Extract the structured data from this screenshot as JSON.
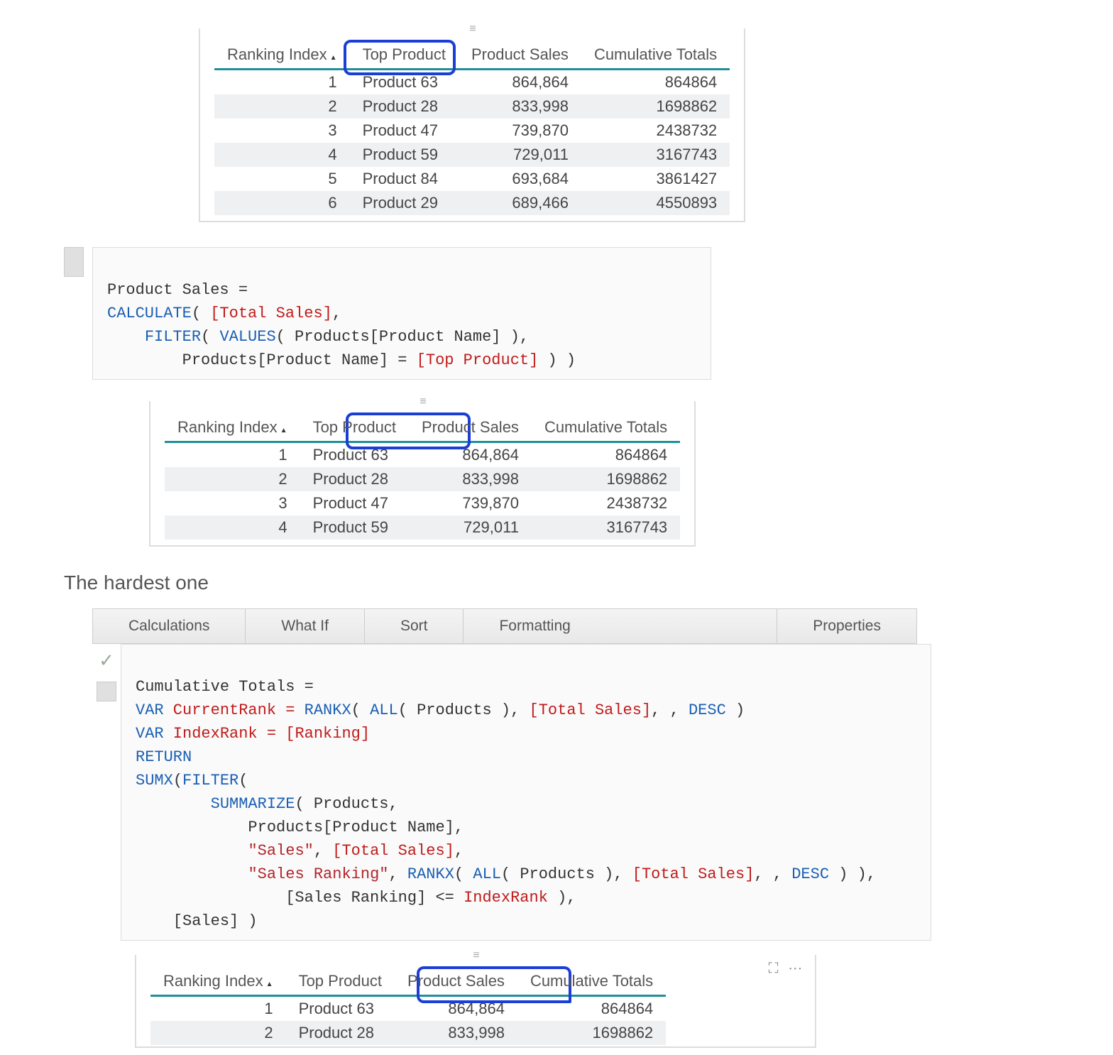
{
  "table1": {
    "headers": [
      "Ranking Index",
      "Top Product",
      "Product Sales",
      "Cumulative Totals"
    ],
    "rows": [
      {
        "idx": "1",
        "prod": "Product 63",
        "sales": "864,864",
        "cum": "864864"
      },
      {
        "idx": "2",
        "prod": "Product 28",
        "sales": "833,998",
        "cum": "1698862"
      },
      {
        "idx": "3",
        "prod": "Product 47",
        "sales": "739,870",
        "cum": "2438732"
      },
      {
        "idx": "4",
        "prod": "Product 59",
        "sales": "729,011",
        "cum": "3167743"
      },
      {
        "idx": "5",
        "prod": "Product 84",
        "sales": "693,684",
        "cum": "3861427"
      },
      {
        "idx": "6",
        "prod": "Product 29",
        "sales": "689,466",
        "cum": "4550893"
      }
    ]
  },
  "dax1": {
    "line1_a": "Product Sales =",
    "line2_fn": "CALCULATE",
    "line2_open": "( ",
    "line2_ref": "[Total Sales]",
    "line2_c": ",",
    "line3_fn1": "FILTER",
    "line3_p1": "( ",
    "line3_fn2": "VALUES",
    "line3_p2": "( Products[Product Name] ),",
    "line4_a": "        Products[Product Name] = ",
    "line4_ref": "[Top Product]",
    "line4_b": " ) )"
  },
  "table2": {
    "headers": [
      "Ranking Index",
      "Top Product",
      "Product Sales",
      "Cumulative Totals"
    ],
    "rows": [
      {
        "idx": "1",
        "prod": "Product 63",
        "sales": "864,864",
        "cum": "864864"
      },
      {
        "idx": "2",
        "prod": "Product 28",
        "sales": "833,998",
        "cum": "1698862"
      },
      {
        "idx": "3",
        "prod": "Product 47",
        "sales": "739,870",
        "cum": "2438732"
      },
      {
        "idx": "4",
        "prod": "Product 59",
        "sales": "729,011",
        "cum": "3167743"
      }
    ]
  },
  "heading": "The hardest one",
  "ribbon": [
    "Calculations",
    "What If",
    "Sort",
    "Formatting",
    "Properties"
  ],
  "dax2": {
    "l1": "Cumulative Totals =",
    "l2_a": "VAR",
    "l2_b": " CurrentRank = ",
    "l2_fn": "RANKX",
    "l2_c": "( ",
    "l2_fn2": "ALL",
    "l2_d": "( Products ), ",
    "l2_ref": "[Total Sales]",
    "l2_e": ", , ",
    "l2_kw": "DESC",
    "l2_f": " )",
    "l3_a": "VAR",
    "l3_b": " IndexRank = ",
    "l3_ref": "[Ranking]",
    "l4": "RETURN",
    "l5_fn": "SUMX",
    "l5_a": "(",
    "l5_fn2": "FILTER",
    "l5_b": "(",
    "l6_fn": "SUMMARIZE",
    "l6_a": "( Products,",
    "l7": "            Products[Product Name],",
    "l8_a": "            ",
    "l8_s": "\"Sales\"",
    "l8_b": ", ",
    "l8_ref": "[Total Sales]",
    "l8_c": ",",
    "l9_a": "            ",
    "l9_s": "\"Sales Ranking\"",
    "l9_b": ", ",
    "l9_fn": "RANKX",
    "l9_c": "( ",
    "l9_fn2": "ALL",
    "l9_d": "( Products ), ",
    "l9_ref": "[Total Sales]",
    "l9_e": ", , ",
    "l9_kw": "DESC",
    "l9_f": " ) ),",
    "l10_a": "                [Sales Ranking] <= ",
    "l10_ref": "IndexRank",
    "l10_b": " ),",
    "l11": "    [Sales] )"
  },
  "table3": {
    "headers": [
      "Ranking Index",
      "Top Product",
      "Product Sales",
      "Cumulative Totals"
    ],
    "rows": [
      {
        "idx": "1",
        "prod": "Product 63",
        "sales": "864,864",
        "cum": "864864"
      },
      {
        "idx": "2",
        "prod": "Product 28",
        "sales": "833,998",
        "cum": "1698862"
      }
    ]
  },
  "chart_data": [
    {
      "type": "table",
      "title": "Ranking table 1",
      "columns": [
        "Ranking Index",
        "Top Product",
        "Product Sales",
        "Cumulative Totals"
      ],
      "rows": [
        [
          1,
          "Product 63",
          864864,
          864864
        ],
        [
          2,
          "Product 28",
          833998,
          1698862
        ],
        [
          3,
          "Product 47",
          739870,
          2438732
        ],
        [
          4,
          "Product 59",
          729011,
          3167743
        ],
        [
          5,
          "Product 84",
          693684,
          3861427
        ],
        [
          6,
          "Product 29",
          689466,
          4550893
        ]
      ]
    },
    {
      "type": "table",
      "title": "Ranking table 2",
      "columns": [
        "Ranking Index",
        "Top Product",
        "Product Sales",
        "Cumulative Totals"
      ],
      "rows": [
        [
          1,
          "Product 63",
          864864,
          864864
        ],
        [
          2,
          "Product 28",
          833998,
          1698862
        ],
        [
          3,
          "Product 47",
          739870,
          2438732
        ],
        [
          4,
          "Product 59",
          729011,
          3167743
        ]
      ]
    },
    {
      "type": "table",
      "title": "Ranking table 3",
      "columns": [
        "Ranking Index",
        "Top Product",
        "Product Sales",
        "Cumulative Totals"
      ],
      "rows": [
        [
          1,
          "Product 63",
          864864,
          864864
        ],
        [
          2,
          "Product 28",
          833998,
          1698862
        ]
      ]
    }
  ]
}
